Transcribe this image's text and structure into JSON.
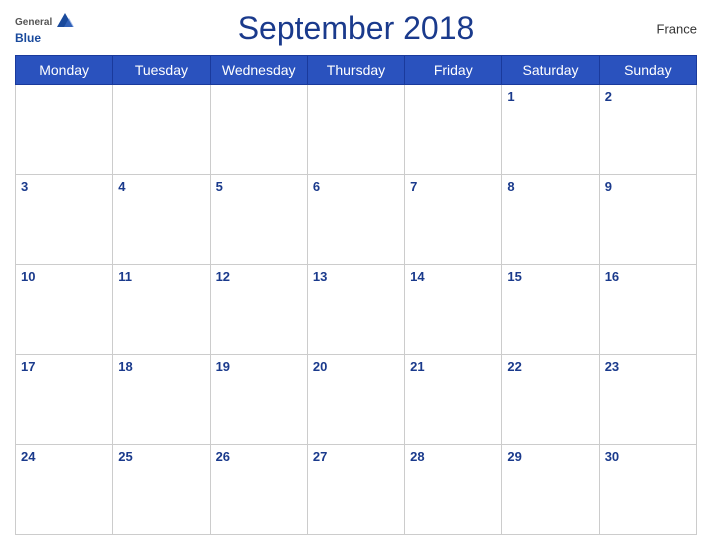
{
  "header": {
    "title": "September 2018",
    "country": "France",
    "logo_general": "General",
    "logo_blue": "Blue"
  },
  "calendar": {
    "days_of_week": [
      "Monday",
      "Tuesday",
      "Wednesday",
      "Thursday",
      "Friday",
      "Saturday",
      "Sunday"
    ],
    "weeks": [
      [
        null,
        null,
        null,
        null,
        null,
        "1",
        "2"
      ],
      [
        "3",
        "4",
        "5",
        "6",
        "7",
        "8",
        "9"
      ],
      [
        "10",
        "11",
        "12",
        "13",
        "14",
        "15",
        "16"
      ],
      [
        "17",
        "18",
        "19",
        "20",
        "21",
        "22",
        "23"
      ],
      [
        "24",
        "25",
        "26",
        "27",
        "28",
        "29",
        "30"
      ]
    ]
  },
  "colors": {
    "header_bg": "#2a52be",
    "title_color": "#1a3a8c",
    "day_number_color": "#1a3a8c"
  }
}
